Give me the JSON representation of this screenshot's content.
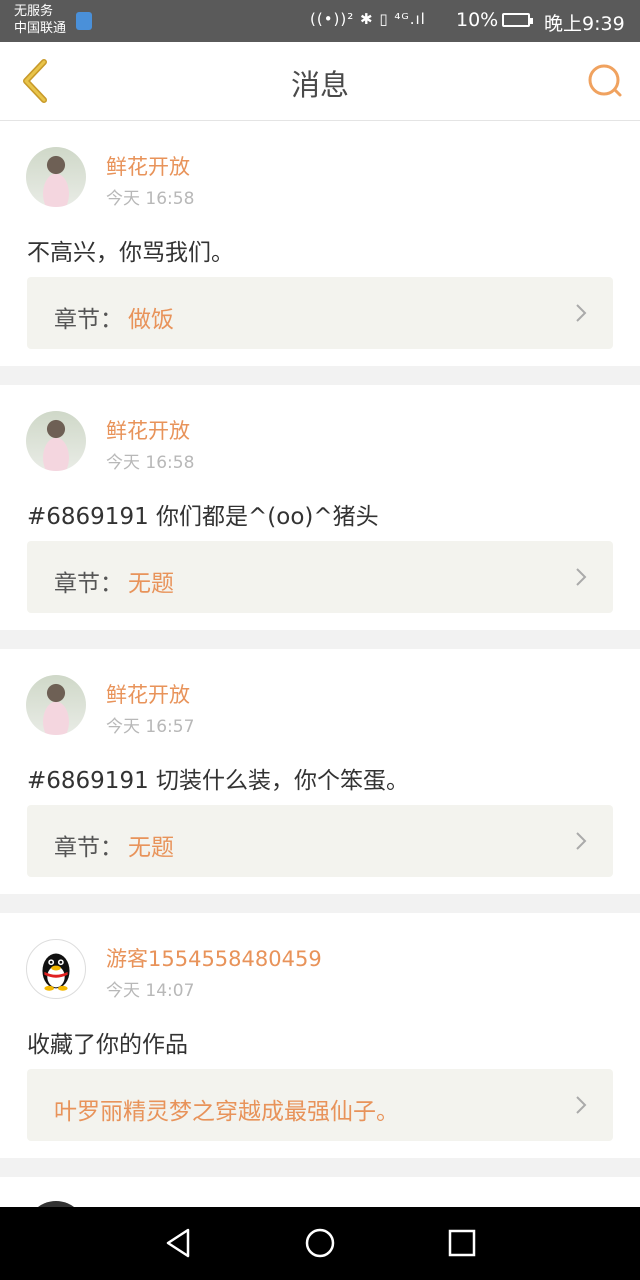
{
  "status_bar": {
    "carrier_line1": "无服务",
    "carrier_line2": "中国联通",
    "signal_text": "((•))² ✱ ▯ ⁴ᴳ.ıl",
    "battery": "10%",
    "time": "晚上9:39"
  },
  "header": {
    "title": "消息",
    "back_icon": "chevron-left",
    "search_icon": "search"
  },
  "colors": {
    "accent": "#e8935a",
    "text": "#333333",
    "muted": "#b8b8b8"
  },
  "messages": [
    {
      "user": "鲜花开放",
      "time": "今天 16:58",
      "text": "不高兴，你骂我们。",
      "chapter_prefix": "章节：",
      "chapter": "做饭"
    },
    {
      "user": "鲜花开放",
      "time": "今天 16:58",
      "text": "#6869191 你们都是^(oo)^猪头",
      "chapter_prefix": "章节：",
      "chapter": "无题"
    },
    {
      "user": "鲜花开放",
      "time": "今天 16:57",
      "text": "#6869191 切装什么装，你个笨蛋。",
      "chapter_prefix": "章节：",
      "chapter": "无题"
    },
    {
      "user": "游客1554558480459",
      "time": "今天 14:07",
      "text": "收藏了你的作品",
      "work": "叶罗丽精灵梦之穿越成最强仙子。"
    }
  ]
}
